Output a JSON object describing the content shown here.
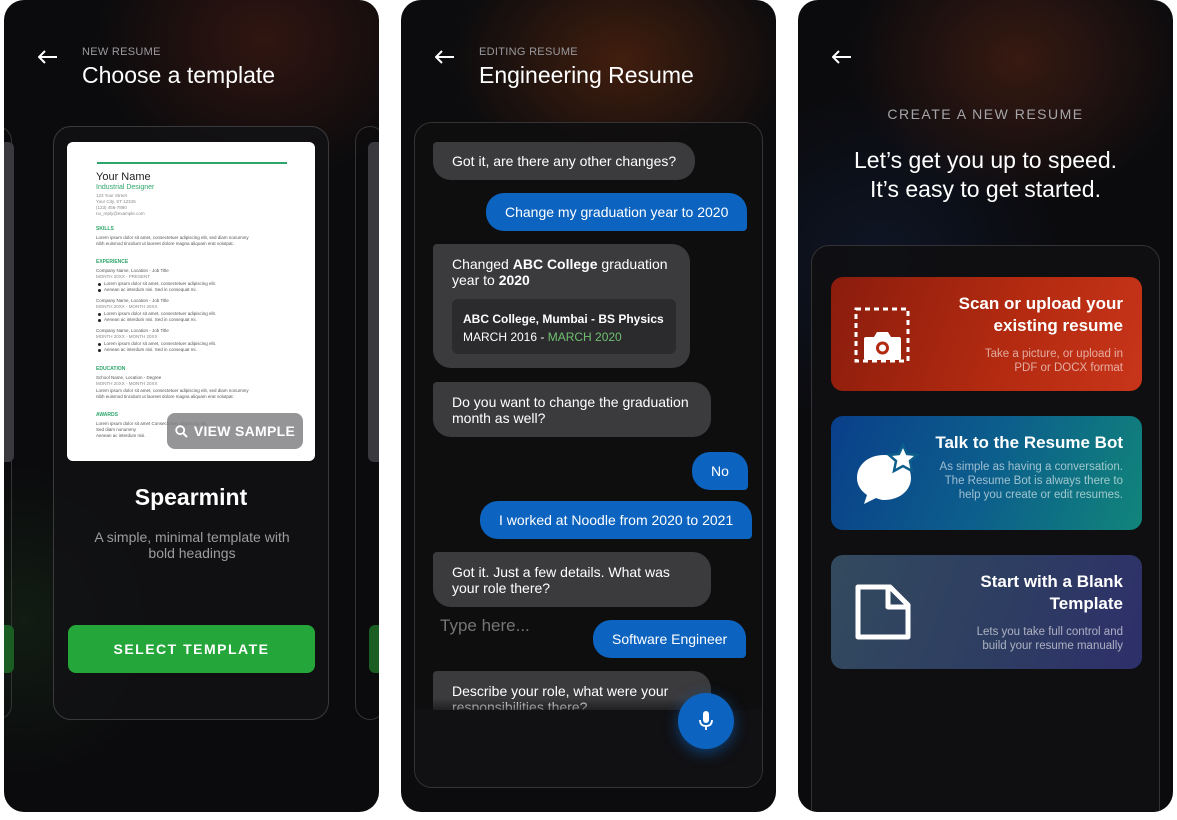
{
  "screen1": {
    "overline": "NEW RESUME",
    "title": "Choose a template",
    "preview": {
      "name": "Your Name",
      "role": "Industrial Designer",
      "address": [
        "123 Your Street",
        "Your City, ST 12345",
        "(123) 456-7890",
        "no_reply@example.com"
      ],
      "skills_heading": "SKILLS",
      "lorem1": "Lorem ipsum dolor sit amet, consectetuer adipiscing elit, sed diam nonummy",
      "lorem2": "nibh euismod tincidunt ut laoreet dolore magna aliquam erat volutpat.",
      "experience_heading": "EXPERIENCE",
      "job_line": "Company Name, Location - Job Title",
      "dates_present": "MONTH 20XX - PRESENT",
      "dates": "MONTH 20XX - MONTH 20XX",
      "bullet1": "Lorem ipsum dolor sit amet, consectetuer adipiscing elit.",
      "bullet2": "Aenean ac interdum nisi. Sed in consequat mi.",
      "education_heading": "EDUCATION",
      "school_line": "School Name, Location - Degree",
      "awards_heading": "AWARDS",
      "awards_line1": "Lorem ipsum dolor sit amet Consectetuer adipiscing elit, Sed diam nonummy",
      "awards_line2": "Aenean ac interdum nisi."
    },
    "view_sample": "VIEW SAMPLE",
    "template_name": "Spearmint",
    "template_desc": "A simple, minimal template with bold headings",
    "select_button": "SELECT TEMPLATE"
  },
  "screen2": {
    "overline": "EDITING RESUME",
    "title": "Engineering Resume",
    "messages": [
      {
        "from": "bot",
        "text": "Got it, are there any other changes?"
      },
      {
        "from": "user",
        "text": "Change my graduation year to 2020"
      },
      {
        "from": "bot",
        "pre": "Changed ",
        "bold1": "ABC College",
        "mid": " graduation year to ",
        "bold2": "2020"
      },
      {
        "from": "bot",
        "text": "Do you want to change the graduation month as well?"
      },
      {
        "from": "user",
        "text": "No"
      },
      {
        "from": "user",
        "text": "I worked at Noodle from 2020 to 2021"
      },
      {
        "from": "bot",
        "text": "Got it. Just a few details. What was your role there?"
      },
      {
        "from": "user",
        "text": "Software Engineer"
      },
      {
        "from": "bot",
        "text": "Describe your role, what were your responsibilities there?"
      }
    ],
    "edu_card": {
      "title": "ABC College, Mumbai - BS Physics",
      "date_start": "MARCH 2016 - ",
      "date_end": "MARCH 2020"
    },
    "input_placeholder": "Type here...",
    "colors": {
      "user_bubble": "#0c64c0",
      "bot_bubble": "#3b3b3e"
    }
  },
  "screen3": {
    "overline": "CREATE A NEW RESUME",
    "hero_line1": "Let’s get you up to speed.",
    "hero_line2": "It’s easy to get started.",
    "options": [
      {
        "icon": "camera-scan-icon",
        "title1": "Scan or upload your",
        "title2": "existing resume",
        "sub1": "Take a picture, or upload in",
        "sub2": "PDF or DOCX format"
      },
      {
        "icon": "chat-star-icon",
        "title1": "Talk to the Resume Bot",
        "sub1": "As simple as having a conversation.",
        "sub2": "The Resume Bot is always there to",
        "sub3": "help you create or edit resumes."
      },
      {
        "icon": "blank-document-icon",
        "title1": "Start with a Blank",
        "title2": "Template",
        "sub1": "Lets you take full control and",
        "sub2": "build your resume manually"
      }
    ],
    "colors": {
      "scan": "#b22a10",
      "bot": "#0c5e8c",
      "blank": "#2e3d62"
    }
  }
}
